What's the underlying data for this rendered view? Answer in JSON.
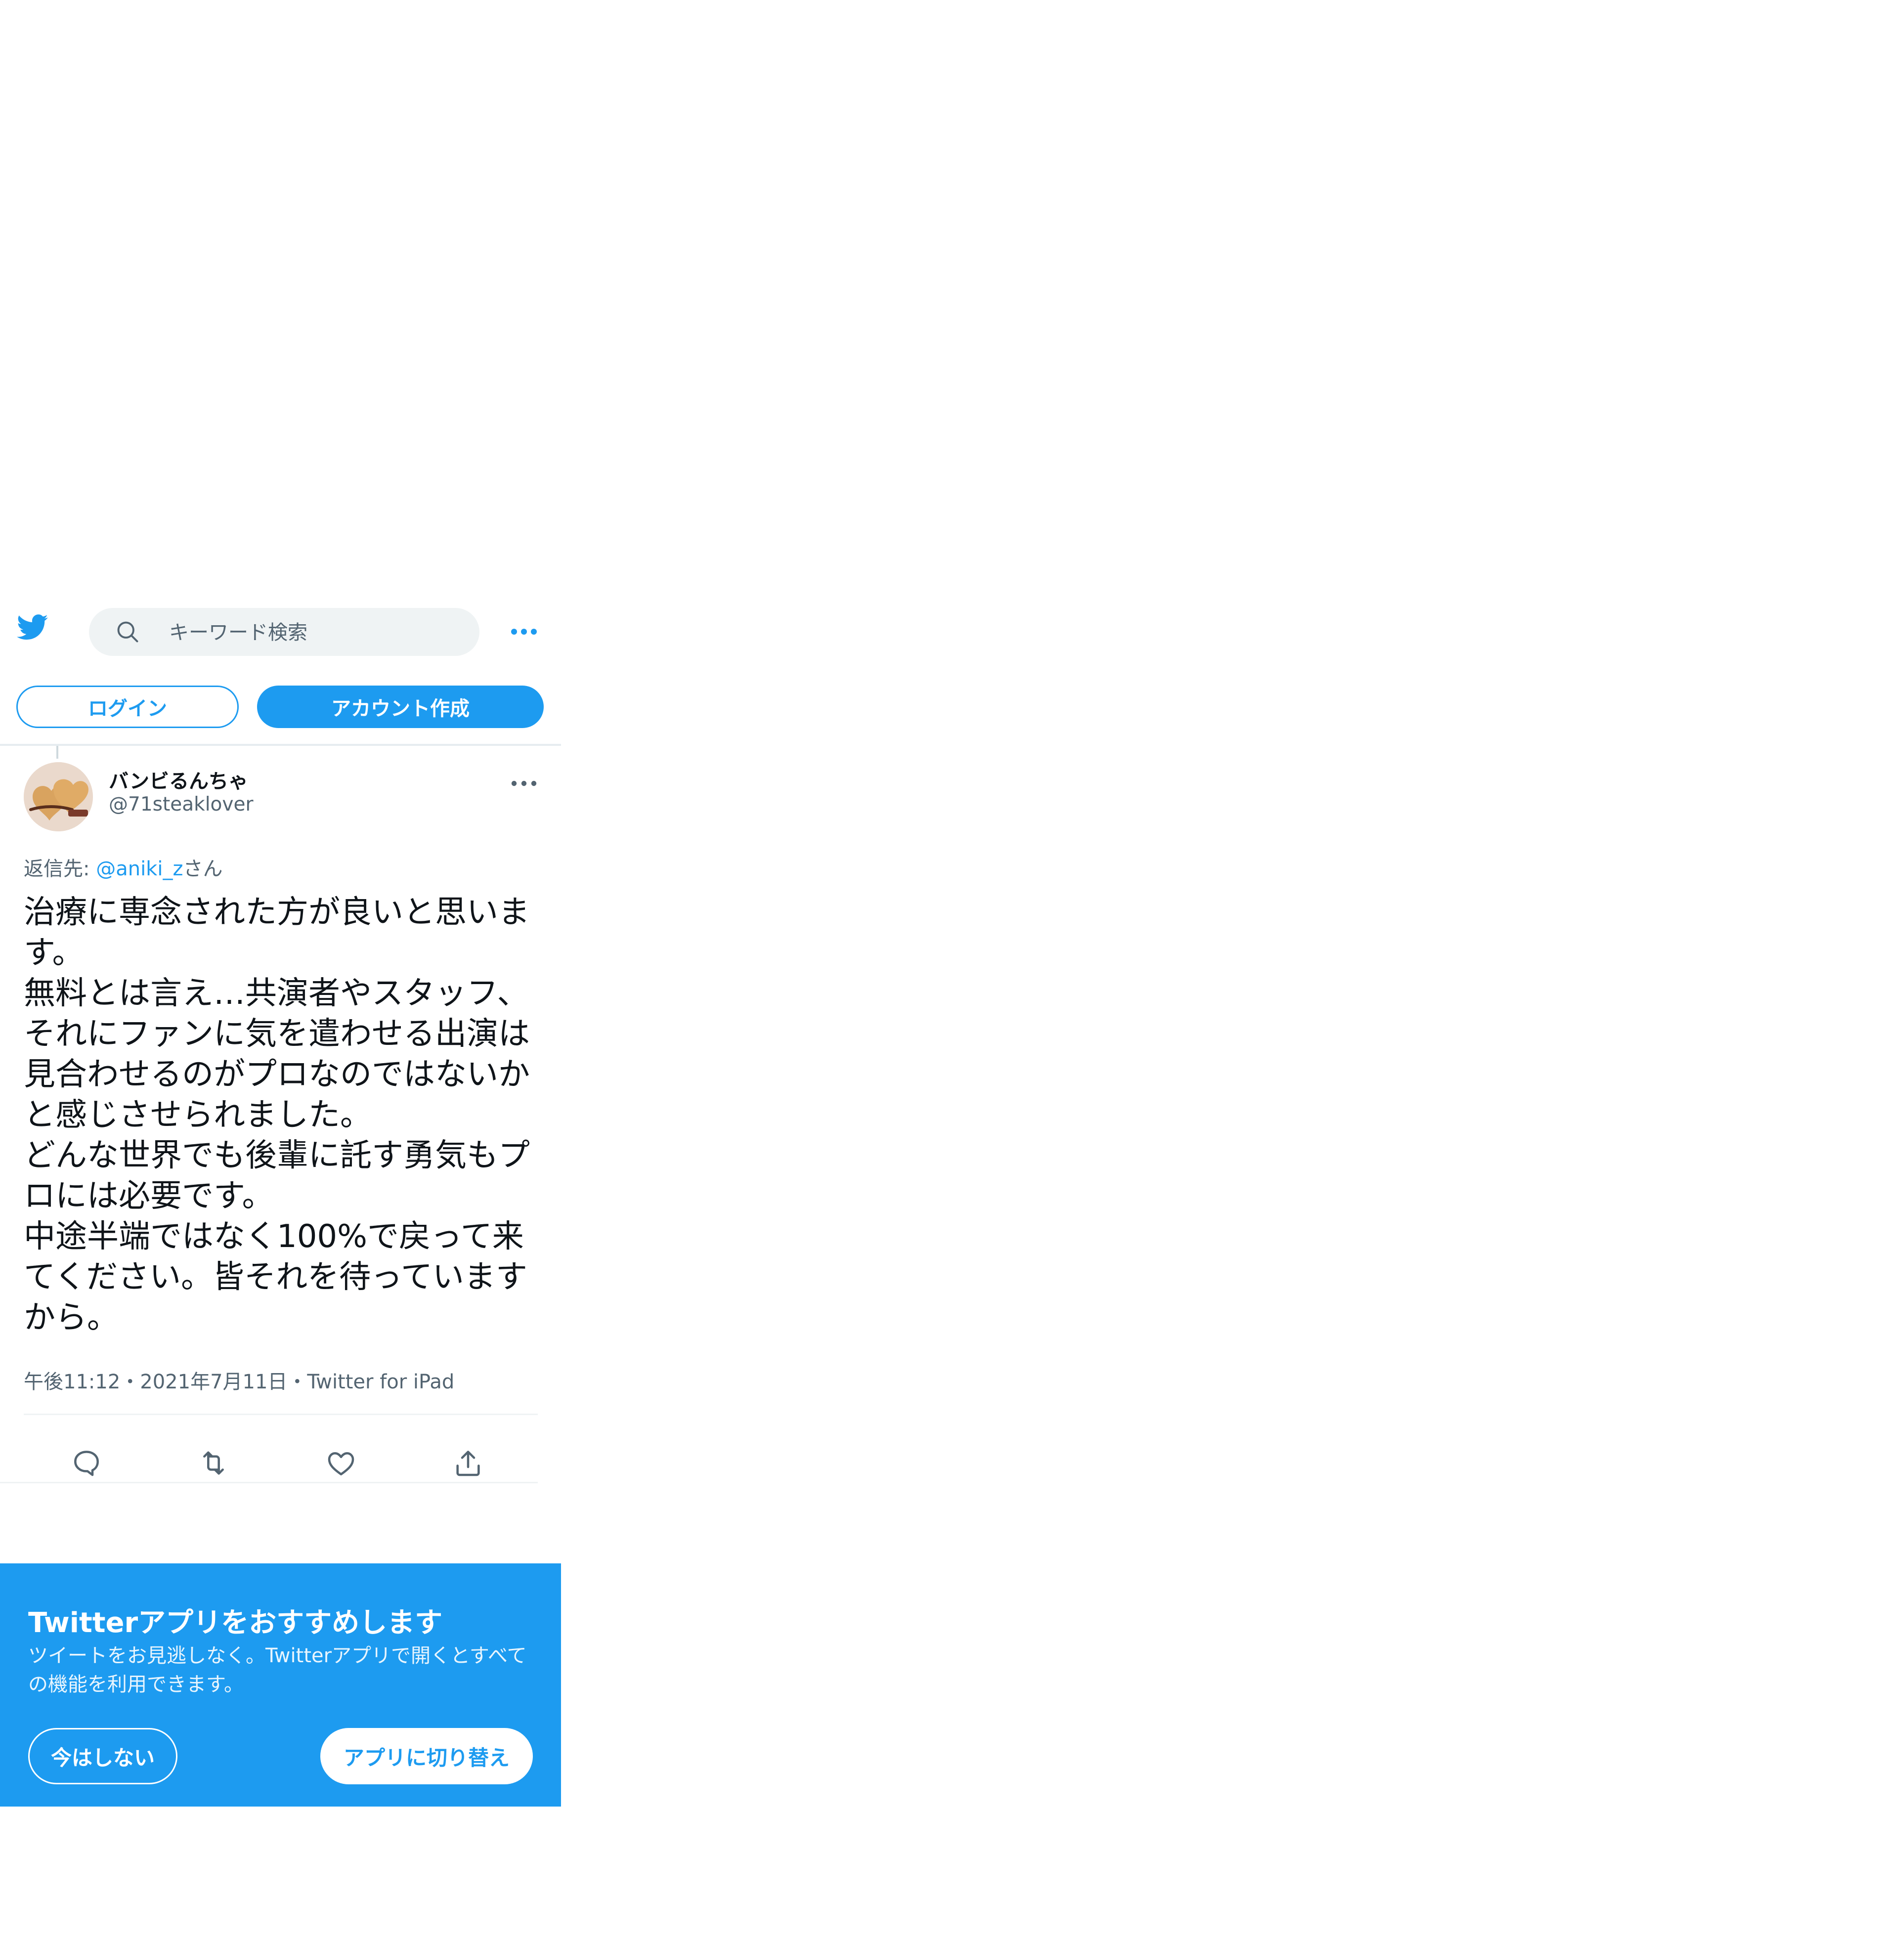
{
  "header": {
    "search_placeholder": "キーワード検索",
    "login_label": "ログイン",
    "signup_label": "アカウント作成"
  },
  "tweet": {
    "display_name": "バンビるんちゃ",
    "handle": "@71steaklover",
    "reply_prefix": "返信先: ",
    "reply_mention": "@aniki_z",
    "reply_suffix": "さん",
    "text": "治療に専念された方が良いと思います。\n無料とは言え…共演者やスタッフ、それにファンに気を遣わせる出演は見合わせるのがプロなのではないかと感じさせられました。\nどんな世界でも後輩に託す勇気もプロには必要です。\n中途半端ではなく100%で戻って来てください。皆それを待っていますから。",
    "meta": "午後11:12・2021年7月11日・Twitter for iPad",
    "actions": [
      "reply-icon",
      "retweet-icon",
      "like-icon",
      "share-icon"
    ]
  },
  "promo": {
    "title": "Twitterアプリをおすすめします",
    "description": "ツイートをお見逃しなく。Twitterアプリで開くとすべての機能を利用できます。",
    "later_label": "今はしない",
    "switch_label": "アプリに切り替え"
  },
  "colors": {
    "accent": "#1d9bf0",
    "text": "#0f1419",
    "muted": "#536471",
    "search_bg": "#eff3f4"
  }
}
